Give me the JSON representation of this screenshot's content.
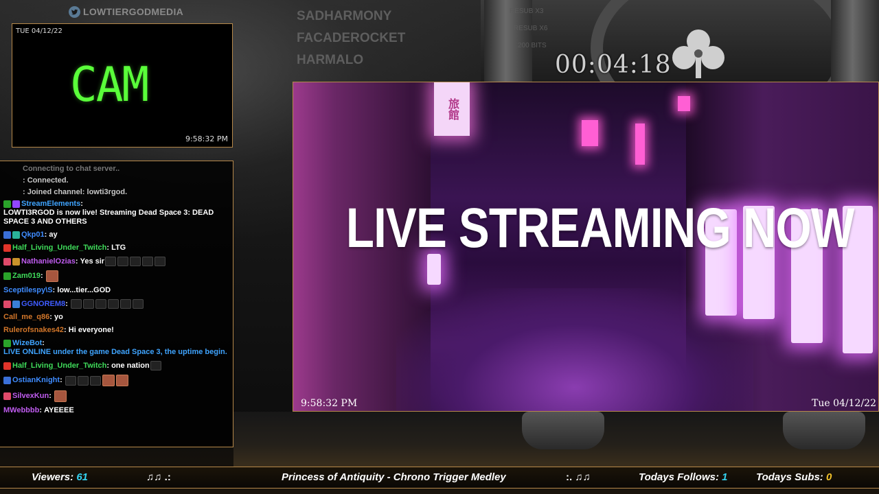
{
  "overlay": {
    "twitter_handle": "LOWTIERGODMEDIA",
    "recent_events": [
      "SADHARMONY",
      "FACADEROCKET",
      "HARMALO"
    ],
    "recent_event_types": [
      "RESUB X3",
      "RESUB X6",
      "200 BITS"
    ],
    "uptime_timer": "00:04:18"
  },
  "cam": {
    "date": "TUE 04/12/22",
    "label": "CAM",
    "time": "9:58:32 PM"
  },
  "chat": {
    "system_messages": [
      "Connecting to chat server..",
      ": Connected.",
      ": Joined channel: lowti3rgod."
    ],
    "messages": [
      {
        "user": "StreamElements",
        "color": "#3fa4ff",
        "badges": [
          "#2aa32a",
          "#9146ff"
        ],
        "text": "LOWTI3RGOD is now live! Streaming Dead Space 3: DEAD SPACE 3 AND OTHERS",
        "emotes": 0
      },
      {
        "user": "Qkp01",
        "color": "#3f8cff",
        "badges": [
          "#3a6fd8",
          "#2ab39a"
        ],
        "text": "ay",
        "emotes": 0
      },
      {
        "user": "Half_Living_Under_Twitch",
        "color": "#3fdb5a",
        "badges": [
          "#e0342a"
        ],
        "text": "LTG",
        "emotes": 0
      },
      {
        "user": "NathanielOzias",
        "color": "#c05cf0",
        "badges": [
          "#e04a6a",
          "#c9922a"
        ],
        "text": "Yes sir",
        "emotes": 5
      },
      {
        "user": "Zam019",
        "color": "#3fdb5a",
        "badges": [
          "#2aa32a"
        ],
        "text": "",
        "emotes": 0,
        "face_emotes": 1
      },
      {
        "user": "Sceptilespy\\S",
        "color": "#3f8cff",
        "badges": [],
        "text": "low...tier...GOD",
        "emotes": 0
      },
      {
        "user": "GGNOREM8",
        "color": "#3f5cff",
        "badges": [
          "#e04a6a",
          "#3a7fd8"
        ],
        "text": "",
        "emotes": 6
      },
      {
        "user": "Call_me_q86",
        "color": "#d2762a",
        "badges": [],
        "text": "yo",
        "emotes": 0
      },
      {
        "user": "Rulerofsnakes42",
        "color": "#d2762a",
        "badges": [],
        "text": "Hi everyone!",
        "emotes": 0
      },
      {
        "user": "WizeBot",
        "color": "#3fa4ff",
        "badges": [
          "#2aa32a"
        ],
        "text": "LIVE ONLINE under the game Dead Space 3, the uptime begin.",
        "emotes": 0,
        "text_color": "#3fa4ff"
      },
      {
        "user": "Half_Living_Under_Twitch",
        "color": "#3fdb5a",
        "badges": [
          "#e0342a"
        ],
        "text": "one nation",
        "emotes": 1
      },
      {
        "user": "OstianKnight",
        "color": "#3f8cff",
        "badges": [
          "#3a6fd8"
        ],
        "text": "",
        "emotes": 3,
        "face_emotes": 2
      },
      {
        "user": "SilvexKun",
        "color": "#c05cf0",
        "badges": [
          "#e04a6a"
        ],
        "text": "",
        "emotes": 0,
        "face_emotes": 1
      },
      {
        "user": "MWebbbb",
        "color": "#c05cf0",
        "badges": [],
        "text": "AYEEEE",
        "emotes": 0
      }
    ]
  },
  "video": {
    "title": "LIVE STREAMING NOW",
    "time": "9:58:32 PM",
    "date": "Tue 04/12/22",
    "sign_text": "旅館"
  },
  "bottom_bar": {
    "viewers_label": "Viewers:",
    "viewers_value": "61",
    "music_left": "♫♫ .:",
    "now_playing": "Princess of Antiquity - Chrono Trigger Medley",
    "music_right": ":. ♫♫",
    "follows_label": "Todays Follows:",
    "follows_value": "1",
    "subs_label": "Todays Subs:",
    "subs_value": "0"
  },
  "colors": {
    "frame_border": "#b7894a",
    "cam_green": "#5aff3a",
    "accent_cyan": "#34d3f1",
    "accent_gold": "#f2c22a"
  }
}
